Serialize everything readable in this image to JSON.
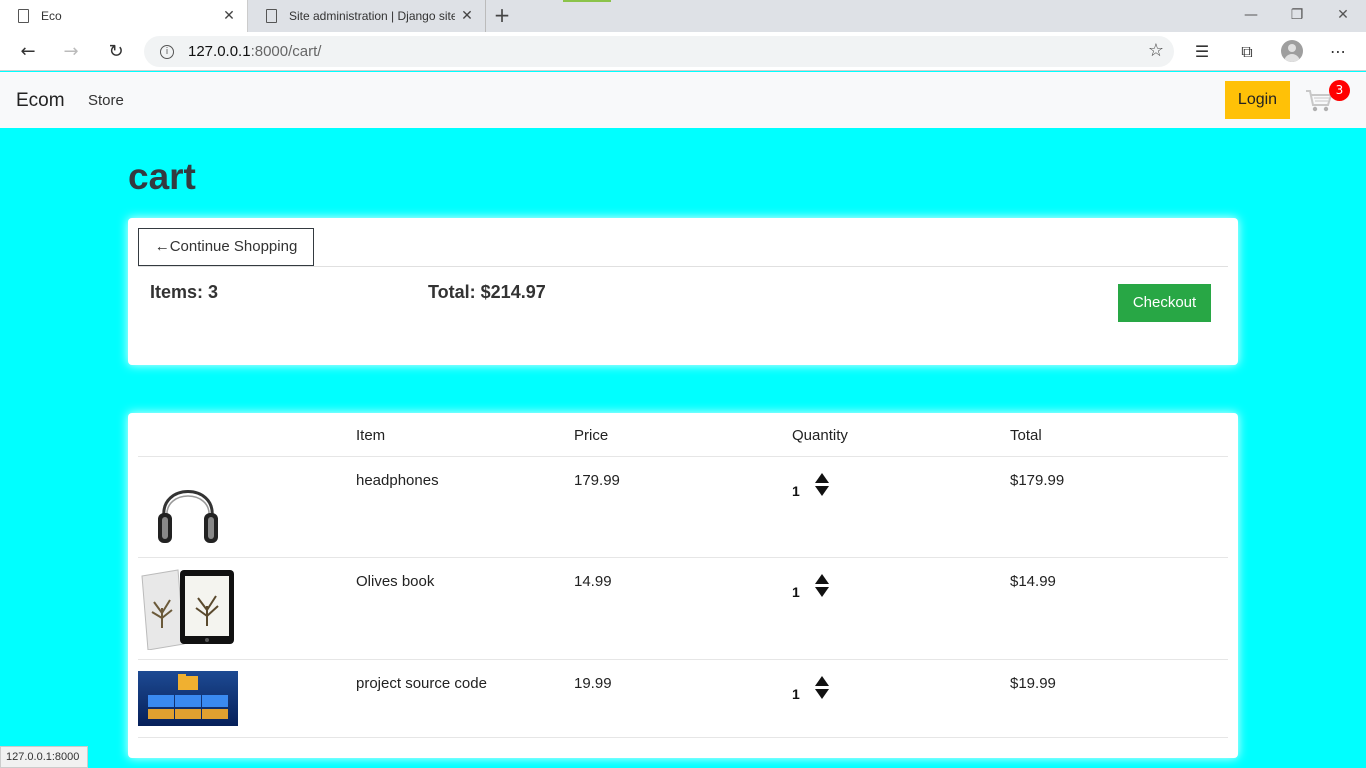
{
  "browser": {
    "tabs": [
      {
        "title": "Eco",
        "active": true
      },
      {
        "title": "Site administration | Django site",
        "active": false
      }
    ],
    "url_host": "127.0.0.1",
    "url_rest": ":8000/cart/",
    "status_text": "127.0.0.1:8000"
  },
  "navbar": {
    "brand": "Ecom",
    "store_link": "Store",
    "login_label": "Login",
    "cart_count": "3",
    "colors": {
      "login_bg": "#ffc107",
      "badge_bg": "#ff0000"
    }
  },
  "page": {
    "title": "cart",
    "background": "#00ffff"
  },
  "summary": {
    "continue_label": "←Continue Shopping",
    "items_label": "Items: 3",
    "total_label": "Total: $214.97",
    "checkout_label": "Checkout",
    "checkout_color": "#28a745"
  },
  "cart": {
    "headers": [
      "Item",
      "Price",
      "Quantity",
      "Total"
    ],
    "rows": [
      {
        "image": "headphones-image",
        "name": "headphones",
        "price": "179.99",
        "quantity": "1",
        "total": "$179.99"
      },
      {
        "image": "book-image",
        "name": "Olives book",
        "price": "14.99",
        "quantity": "1",
        "total": "$14.99"
      },
      {
        "image": "source-code-image",
        "name": "project source code",
        "price": "19.99",
        "quantity": "1",
        "total": "$19.99"
      }
    ]
  }
}
